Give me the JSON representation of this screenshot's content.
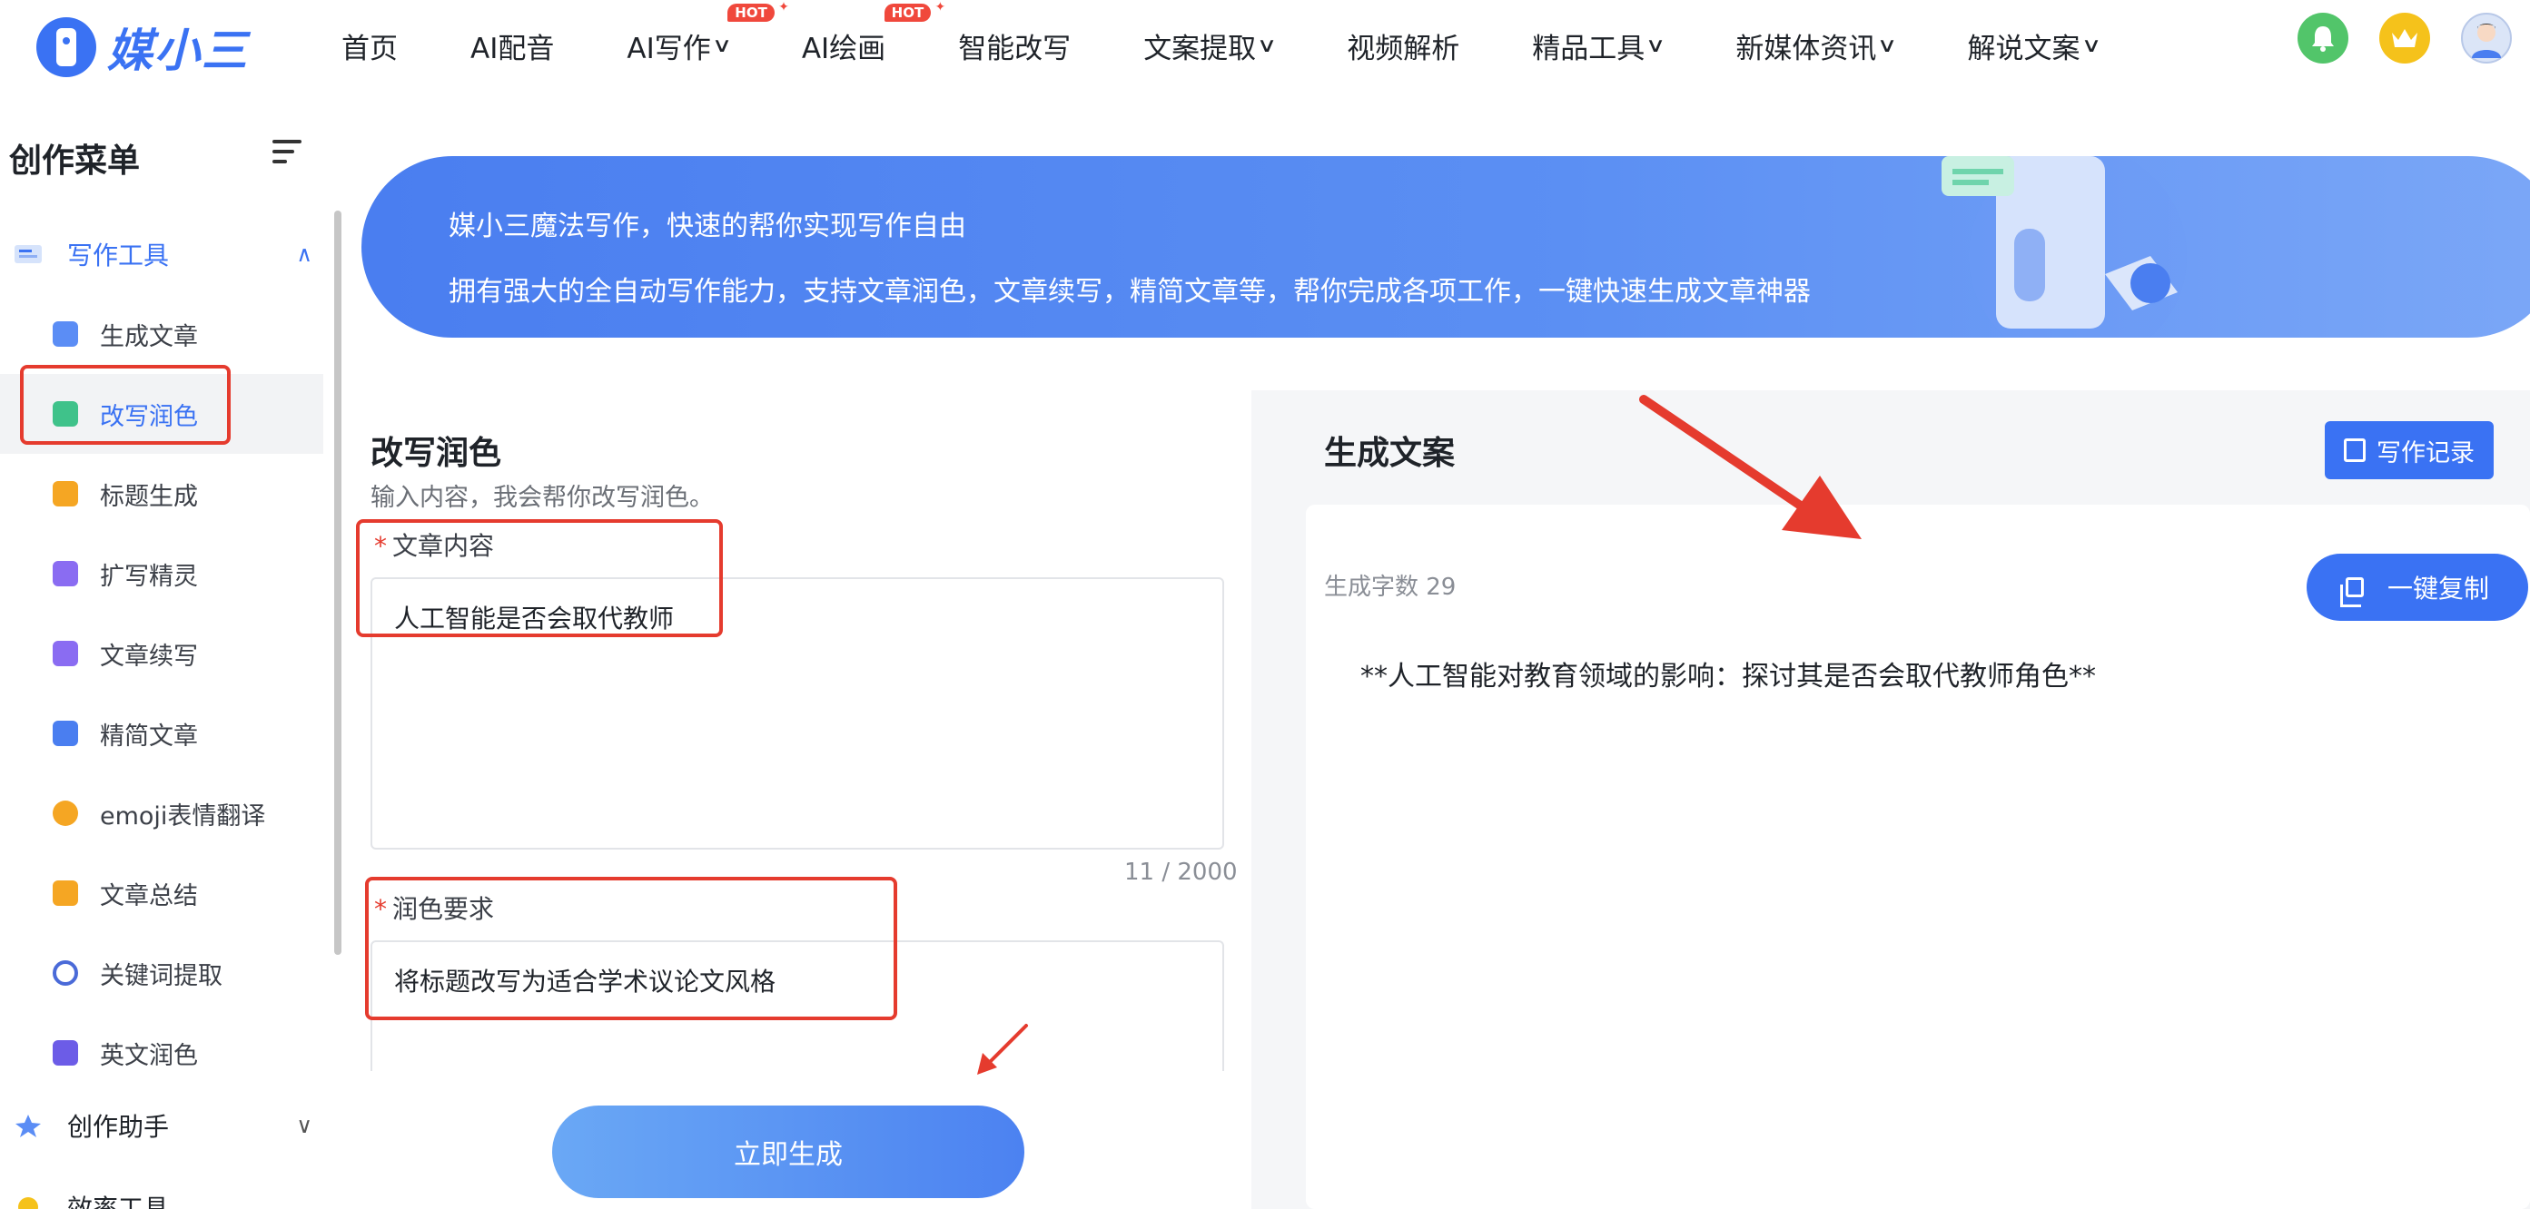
{
  "brand": {
    "name": "媒小三",
    "accent": "#3a72f3"
  },
  "nav": {
    "items": [
      {
        "label": "首页",
        "dropdown": false,
        "hot": false
      },
      {
        "label": "AI配音",
        "dropdown": false,
        "hot": false
      },
      {
        "label": "AI写作",
        "dropdown": true,
        "hot": true
      },
      {
        "label": "AI绘画",
        "dropdown": false,
        "hot": true
      },
      {
        "label": "智能改写",
        "dropdown": false,
        "hot": false
      },
      {
        "label": "文案提取",
        "dropdown": true,
        "hot": false
      },
      {
        "label": "视频解析",
        "dropdown": false,
        "hot": false
      },
      {
        "label": "精品工具",
        "dropdown": true,
        "hot": false
      },
      {
        "label": "新媒体资讯",
        "dropdown": true,
        "hot": false
      },
      {
        "label": "解说文案",
        "dropdown": true,
        "hot": false
      }
    ],
    "hot_badge": "HOT",
    "icons": [
      "bell-icon",
      "crown-icon",
      "avatar"
    ]
  },
  "sidebar": {
    "title": "创作菜单",
    "group_writing": "写作工具",
    "items": [
      {
        "label": "生成文章",
        "icon": "generate-article-icon",
        "color": "#5b8df5"
      },
      {
        "label": "改写润色",
        "icon": "rewrite-polish-icon",
        "color": "#3fc28a",
        "selected": true
      },
      {
        "label": "标题生成",
        "icon": "title-generate-icon",
        "color": "#f5a623"
      },
      {
        "label": "扩写精灵",
        "icon": "expand-writing-icon",
        "color": "#8a6cf2"
      },
      {
        "label": "文章续写",
        "icon": "continue-writing-icon",
        "color": "#8a6cf2"
      },
      {
        "label": "精简文章",
        "icon": "simplify-article-icon",
        "color": "#4a7ef0"
      },
      {
        "label": "emoji表情翻译",
        "icon": "emoji-translate-icon",
        "color": "#f5a623"
      },
      {
        "label": "文章总结",
        "icon": "article-summary-icon",
        "color": "#f5a623"
      },
      {
        "label": "关键词提取",
        "icon": "keyword-extract-icon",
        "color": "#4a6ad8"
      },
      {
        "label": "英文润色",
        "icon": "english-polish-icon",
        "color": "#6c5ce7"
      }
    ],
    "group_assistant": "创作助手",
    "group_cutoff": "效率工具"
  },
  "banner": {
    "line1": "媒小三魔法写作，快速的帮你实现写作自由",
    "line2": "拥有强大的全自动写作能力，支持文章润色，文章续写，精简文章等，帮你完成各项工作，一键快速生成文章神器"
  },
  "form": {
    "title": "改写润色",
    "subtitle": "输入内容，我会帮你改写润色。",
    "content_label": "文章内容",
    "content_value": "人工智能是否会取代教师",
    "content_counter": "11 / 2000",
    "require_label": "润色要求",
    "require_value": "将标题改写为适合学术议论文风格",
    "submit": "立即生成"
  },
  "result": {
    "title": "生成文案",
    "record_button": "写作记录",
    "word_count": "生成字数 29",
    "copy_button": "一键复制",
    "text": "**人工智能对教育领域的影响：探讨其是否会取代教师角色**"
  },
  "annotation_color": "#e53b2e"
}
